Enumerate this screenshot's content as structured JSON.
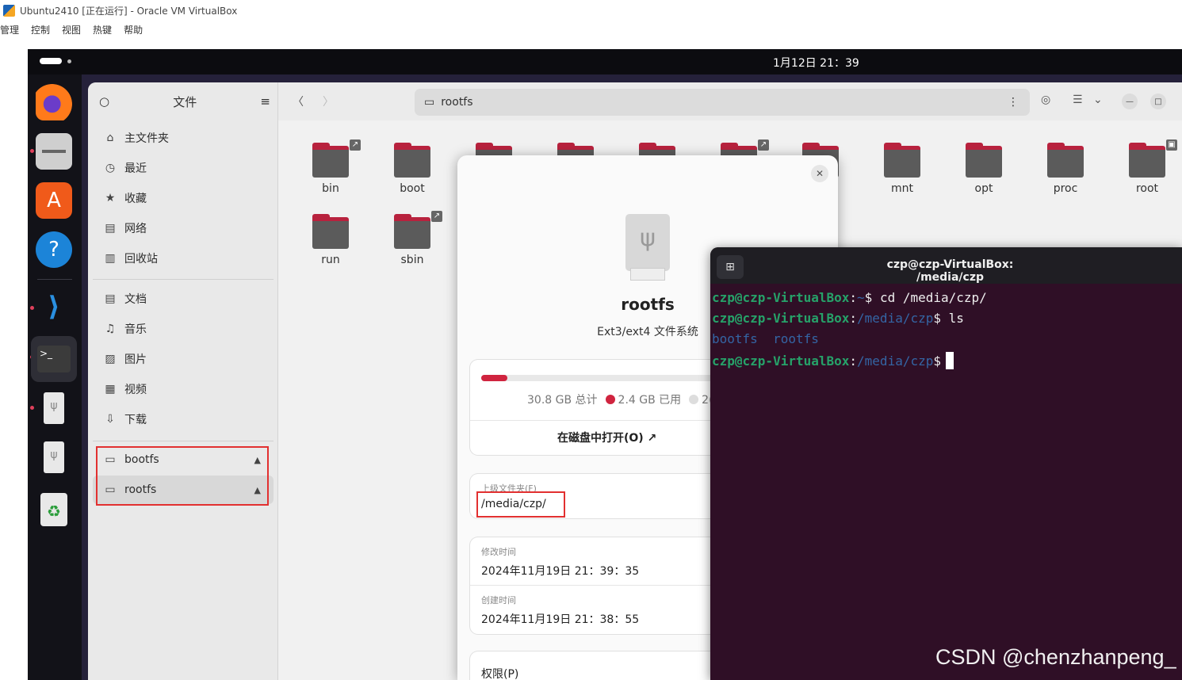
{
  "host": {
    "title": "Ubuntu2410 [正在运行] - Oracle VM VirtualBox",
    "menu": [
      "管理",
      "控制",
      "视图",
      "热键",
      "帮助"
    ]
  },
  "topbar": {
    "clock": "1月12日  21：39"
  },
  "dock": {
    "items": [
      "firefox-icon",
      "files-icon",
      "app-center-icon",
      "help-icon",
      "vscode-icon",
      "terminal-icon",
      "usb-drive-icon",
      "usb-drive-icon",
      "trash-icon"
    ]
  },
  "files": {
    "sidebar_title": "文件",
    "places": [
      {
        "label": "主文件夹",
        "icon": "home-icon"
      },
      {
        "label": "最近",
        "icon": "clock-icon"
      },
      {
        "label": "收藏",
        "icon": "star-icon"
      },
      {
        "label": "网络",
        "icon": "network-icon"
      },
      {
        "label": "回收站",
        "icon": "trash-icon"
      }
    ],
    "folders_side": [
      {
        "label": "文档"
      },
      {
        "label": "音乐"
      },
      {
        "label": "图片"
      },
      {
        "label": "视频"
      },
      {
        "label": "下载"
      }
    ],
    "devices": [
      {
        "label": "bootfs"
      },
      {
        "label": "rootfs"
      }
    ],
    "path": "rootfs",
    "grid": [
      {
        "label": "bin",
        "link": true
      },
      {
        "label": "boot",
        "link": false
      },
      {
        "label": "",
        "link": false
      },
      {
        "label": "",
        "link": false
      },
      {
        "label": "",
        "link": false
      },
      {
        "label": "",
        "link": true
      },
      {
        "label": "",
        "link": false
      },
      {
        "label": "mnt",
        "link": false
      },
      {
        "label": "opt",
        "link": false
      },
      {
        "label": "proc",
        "link": false
      },
      {
        "label": "root",
        "link": false,
        "locked": true
      },
      {
        "label": "run",
        "link": false
      },
      {
        "label": "sbin",
        "link": true
      }
    ]
  },
  "props": {
    "name": "rootfs",
    "fs": "Ext3/ext4 文件系统",
    "usage_fraction": 0.078,
    "total": "30.8 GB 总计",
    "used": "2.4 GB 已用",
    "free_partial": "2(",
    "open_disk": "在磁盘中打开(O)",
    "parent_caption": "上级文件夹(F)",
    "parent_value": "/media/czp/",
    "modified_caption": "修改时间",
    "modified_value": "2024年11月19日 21：39：35",
    "created_caption": "创建时间",
    "created_value": "2024年11月19日 21：38：55",
    "perm": "权限(P)"
  },
  "terminal": {
    "title": "czp@czp-VirtualBox: /media/czp",
    "lines": [
      {
        "user": "czp@czp-VirtualBox",
        "sep": ":",
        "dir": "~",
        "cmd": "$ cd /media/czp/"
      },
      {
        "user": "czp@czp-VirtualBox",
        "sep": ":",
        "dir": "/media/czp",
        "cmd": "$ ls"
      },
      {
        "out1": "bootfs",
        "out2": "rootfs"
      },
      {
        "user": "czp@czp-VirtualBox",
        "sep": ":",
        "dir": "/media/czp",
        "cmd": "$"
      }
    ]
  },
  "watermark": "CSDN @chenzhanpeng_"
}
